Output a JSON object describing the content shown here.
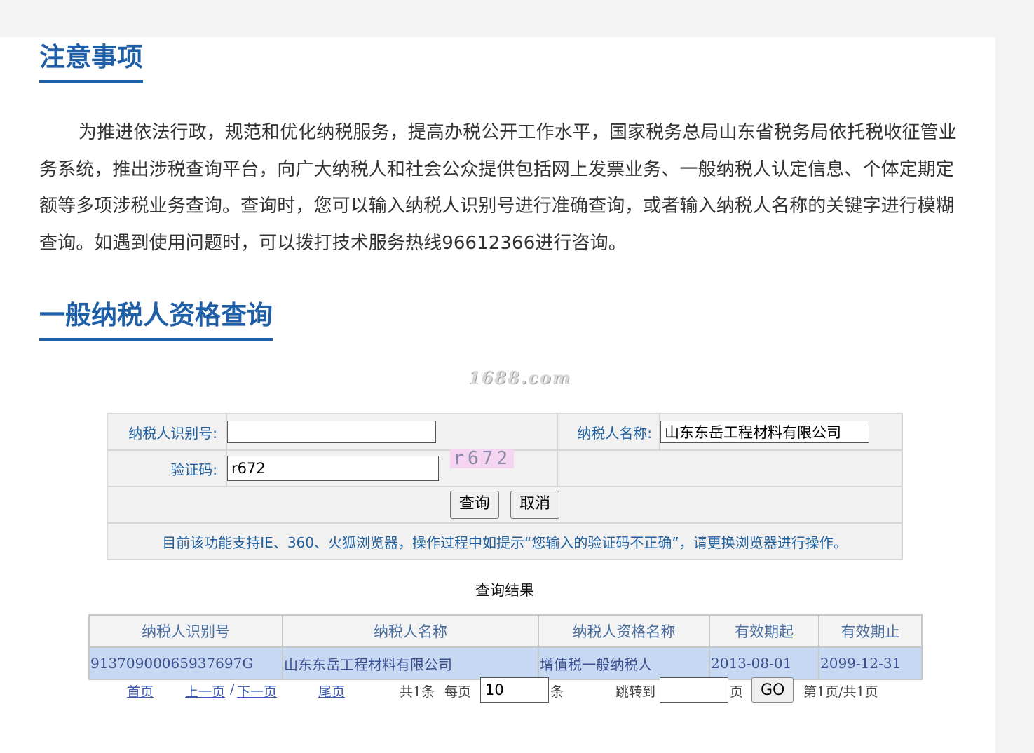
{
  "notice": {
    "title": "注意事项",
    "body": "为推进依法行政，规范和优化纳税服务，提高办税公开工作水平，国家税务总局山东省税务局依托税收征管业务系统，推出涉税查询平台，向广大纳税人和社会公众提供包括网上发票业务、一般纳税人认定信息、个体定期定额等多项涉税业务查询。查询时，您可以输入纳税人识别号进行准确查询，或者输入纳税人名称的关键字进行模糊查询。如遇到使用问题时，可以拨打技术服务热线96612366进行咨询。"
  },
  "query": {
    "title": "一般纳税人资格查询",
    "watermark": "1688.com",
    "taxpayer_id_label": "纳税人识别号:",
    "taxpayer_id_value": "",
    "taxpayer_name_label": "纳税人名称:",
    "taxpayer_name_value": "山东东岳工程材料有限公司",
    "captcha_label": "验证码:",
    "captcha_value": "r672",
    "captcha_image_text": "r672",
    "submit_label": "查询",
    "cancel_label": "取消",
    "tip": "目前该功能支持IE、360、火狐浏览器，操作过程中如提示“您输入的验证码不正确”，请更换浏览器进行操作。"
  },
  "results": {
    "caption": "查询结果",
    "columns": [
      "纳税人识别号",
      "纳税人名称",
      "纳税人资格名称",
      "有效期起",
      "有效期止"
    ],
    "rows": [
      [
        "91370900065937697G",
        "山东东岳工程材料有限公司",
        "增值税一般纳税人",
        "2013-08-01",
        "2099-12-31"
      ]
    ]
  },
  "pager": {
    "first": "首页",
    "prev": "上一页",
    "sep": "/",
    "next": "下一页",
    "last": "尾页",
    "total": "共1条",
    "per_page_label": "每页",
    "per_page_value": "10",
    "per_page_unit": "条",
    "jump_label": "跳转到",
    "jump_value": "",
    "page_unit": "页",
    "go_label": "GO",
    "status": "第1页/共1页"
  }
}
